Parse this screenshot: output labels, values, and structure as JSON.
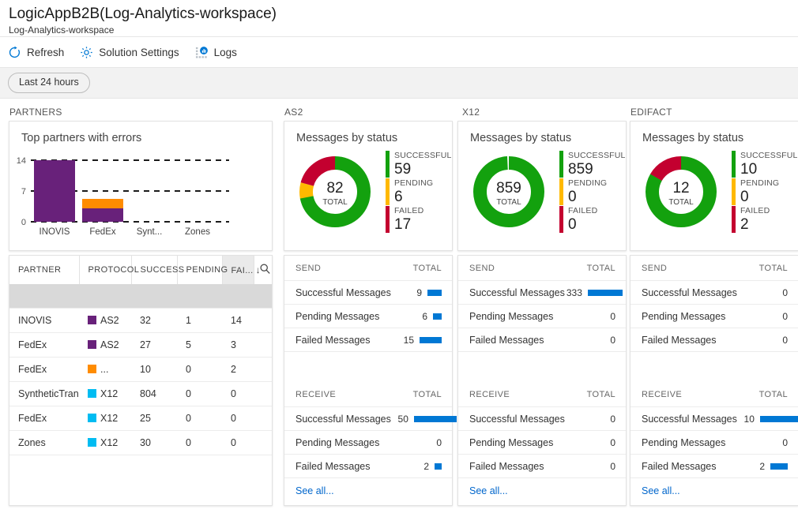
{
  "header": {
    "title": "LogicAppB2B(Log-Analytics-workspace)",
    "subtitle": "Log-Analytics-workspace"
  },
  "toolbar": {
    "refresh_label": "Refresh",
    "settings_label": "Solution Settings",
    "logs_label": "Logs"
  },
  "filter": {
    "time_range": "Last 24 hours"
  },
  "columns": {
    "partners": "PARTNERS",
    "as2": "AS2",
    "x12": "X12",
    "edifact": "EDIFACT"
  },
  "colors": {
    "green": "#13A10E",
    "yellow": "#FFB900",
    "red": "#C3002F",
    "purple": "#68217A",
    "orange": "#FF8C00",
    "cyan": "#00BCF2",
    "blue": "#0078D4",
    "link": "#0066CC"
  },
  "partners_panel": {
    "chart_title": "Top partners with errors",
    "table": {
      "headers": [
        "PARTNER",
        "PROTOCOL",
        "SUCCESS",
        "PENDING",
        "FAI..."
      ],
      "sorted_column": "FAI...",
      "sort_direction": "descending",
      "search_icon": "search-icon",
      "rows": [
        {
          "partner": "INOVIS",
          "protocol": "AS2",
          "protocol_color": "#68217A",
          "success": "32",
          "pending": "1",
          "failed": "14"
        },
        {
          "partner": "FedEx",
          "protocol": "AS2",
          "protocol_color": "#68217A",
          "success": "27",
          "pending": "5",
          "failed": "3"
        },
        {
          "partner": "FedEx",
          "protocol": "...",
          "protocol_color": "#FF8C00",
          "success": "10",
          "pending": "0",
          "failed": "2"
        },
        {
          "partner": "SyntheticTrans",
          "protocol": "X12",
          "protocol_color": "#00BCF2",
          "success": "804",
          "pending": "0",
          "failed": "0"
        },
        {
          "partner": "FedEx",
          "protocol": "X12",
          "protocol_color": "#00BCF2",
          "success": "25",
          "pending": "0",
          "failed": "0"
        },
        {
          "partner": "Zones",
          "protocol": "X12",
          "protocol_color": "#00BCF2",
          "success": "30",
          "pending": "0",
          "failed": "0"
        }
      ]
    }
  },
  "chart_data": [
    {
      "type": "bar",
      "title": "Top partners with errors",
      "stacked": true,
      "categories": [
        "INOVIS",
        "FedEx",
        "Synt...",
        "Zones"
      ],
      "series": [
        {
          "name": "AS2",
          "color": "#68217A",
          "values": [
            14,
            3,
            0,
            0
          ]
        },
        {
          "name": "EDIFACT",
          "color": "#FF8C00",
          "values": [
            0,
            2,
            0,
            0
          ]
        }
      ],
      "ylim": [
        0,
        14
      ],
      "yticks": [
        0,
        7,
        14
      ],
      "ytick_labels": [
        "0",
        "7",
        "14"
      ],
      "xlabel": "",
      "ylabel": "",
      "grid": true,
      "grid_style": "dashed",
      "legend": "none"
    },
    {
      "type": "pie",
      "variant": "donut",
      "panel": "AS2",
      "title": "Messages by status",
      "center_value": "82",
      "center_label": "TOTAL",
      "labels": [
        "SUCCESSFUL",
        "PENDING",
        "FAILED"
      ],
      "values": [
        59,
        6,
        17
      ],
      "colors": [
        "#13A10E",
        "#FFB900",
        "#C3002F"
      ],
      "legend": "right"
    },
    {
      "type": "pie",
      "variant": "donut",
      "panel": "X12",
      "title": "Messages by status",
      "center_value": "859",
      "center_label": "TOTAL",
      "labels": [
        "SUCCESSFUL",
        "PENDING",
        "FAILED"
      ],
      "values": [
        859,
        0,
        0
      ],
      "colors": [
        "#13A10E",
        "#FFB900",
        "#C3002F"
      ],
      "legend": "right"
    },
    {
      "type": "pie",
      "variant": "donut",
      "panel": "EDIFACT",
      "title": "Messages by status",
      "center_value": "12",
      "center_label": "TOTAL",
      "labels": [
        "SUCCESSFUL",
        "PENDING",
        "FAILED"
      ],
      "values": [
        10,
        0,
        2
      ],
      "colors": [
        "#13A10E",
        "#FFB900",
        "#C3002F"
      ],
      "legend": "right"
    },
    {
      "type": "bar",
      "variant": "horizontal",
      "panel": "AS2",
      "section": "SEND",
      "categories": [
        "Successful Messages",
        "Pending Messages",
        "Failed Messages"
      ],
      "values": [
        9,
        6,
        15
      ],
      "color": "#0078D4"
    },
    {
      "type": "bar",
      "variant": "horizontal",
      "panel": "AS2",
      "section": "RECEIVE",
      "categories": [
        "Successful Messages",
        "Pending Messages",
        "Failed Messages"
      ],
      "values": [
        50,
        0,
        2
      ],
      "color": "#0078D4"
    },
    {
      "type": "bar",
      "variant": "horizontal",
      "panel": "X12",
      "section": "SEND",
      "categories": [
        "Successful Messages",
        "Pending Messages",
        "Failed Messages"
      ],
      "values": [
        333,
        0,
        0
      ],
      "color": "#0078D4"
    },
    {
      "type": "bar",
      "variant": "horizontal",
      "panel": "X12",
      "section": "RECEIVE",
      "categories": [
        "Successful Messages",
        "Pending Messages",
        "Failed Messages"
      ],
      "values": [
        0,
        0,
        0
      ],
      "color": "#0078D4"
    },
    {
      "type": "bar",
      "variant": "horizontal",
      "panel": "EDIFACT",
      "section": "SEND",
      "categories": [
        "Successful Messages",
        "Pending Messages",
        "Failed Messages"
      ],
      "values": [
        0,
        0,
        0
      ],
      "color": "#0078D4"
    },
    {
      "type": "bar",
      "variant": "horizontal",
      "panel": "EDIFACT",
      "section": "RECEIVE",
      "categories": [
        "Successful Messages",
        "Pending Messages",
        "Failed Messages"
      ],
      "values": [
        10,
        0,
        2
      ],
      "color": "#0078D4"
    }
  ],
  "protocol_panels": [
    {
      "key": "as2",
      "donut_title": "Messages by status",
      "total": "82",
      "total_label": "TOTAL",
      "legend": [
        {
          "name": "SUCCESSFUL",
          "value": "59",
          "color": "#13A10E"
        },
        {
          "name": "PENDING",
          "value": "6",
          "color": "#FFB900"
        },
        {
          "name": "FAILED",
          "value": "17",
          "color": "#C3002F"
        }
      ],
      "send": {
        "section_label": "SEND",
        "total_label": "TOTAL",
        "rows": [
          {
            "label": "Successful Messages",
            "value": "9",
            "bar": 31
          },
          {
            "label": "Pending Messages",
            "value": "6",
            "bar": 20
          },
          {
            "label": "Failed Messages",
            "value": "15",
            "bar": 44
          }
        ]
      },
      "receive": {
        "section_label": "RECEIVE",
        "total_label": "TOTAL",
        "rows": [
          {
            "label": "Successful Messages",
            "value": "50",
            "bar": 62
          },
          {
            "label": "Pending Messages",
            "value": "0",
            "bar": 0
          },
          {
            "label": "Failed Messages",
            "value": "2",
            "bar": 11
          }
        ]
      },
      "see_all": "See all..."
    },
    {
      "key": "x12",
      "donut_title": "Messages by status",
      "total": "859",
      "total_label": "TOTAL",
      "legend": [
        {
          "name": "SUCCESSFUL",
          "value": "859",
          "color": "#13A10E"
        },
        {
          "name": "PENDING",
          "value": "0",
          "color": "#FFB900"
        },
        {
          "name": "FAILED",
          "value": "0",
          "color": "#C3002F"
        }
      ],
      "send": {
        "section_label": "SEND",
        "total_label": "TOTAL",
        "rows": [
          {
            "label": "Successful Messages",
            "value": "333",
            "bar": 58
          },
          {
            "label": "Pending Messages",
            "value": "0",
            "bar": 0
          },
          {
            "label": "Failed Messages",
            "value": "0",
            "bar": 0
          }
        ]
      },
      "receive": {
        "section_label": "RECEIVE",
        "total_label": "TOTAL",
        "rows": [
          {
            "label": "Successful Messages",
            "value": "0",
            "bar": 0
          },
          {
            "label": "Pending Messages",
            "value": "0",
            "bar": 0
          },
          {
            "label": "Failed Messages",
            "value": "0",
            "bar": 0
          }
        ]
      },
      "see_all": "See all..."
    },
    {
      "key": "edifact",
      "donut_title": "Messages by status",
      "total": "12",
      "total_label": "TOTAL",
      "legend": [
        {
          "name": "SUCCESSFUL",
          "value": "10",
          "color": "#13A10E"
        },
        {
          "name": "PENDING",
          "value": "0",
          "color": "#FFB900"
        },
        {
          "name": "FAILED",
          "value": "2",
          "color": "#C3002F"
        }
      ],
      "send": {
        "section_label": "SEND",
        "total_label": "TOTAL",
        "rows": [
          {
            "label": "Successful Messages",
            "value": "0",
            "bar": 0
          },
          {
            "label": "Pending Messages",
            "value": "0",
            "bar": 0
          },
          {
            "label": "Failed Messages",
            "value": "0",
            "bar": 0
          }
        ]
      },
      "receive": {
        "section_label": "RECEIVE",
        "total_label": "TOTAL",
        "rows": [
          {
            "label": "Successful Messages",
            "value": "10",
            "bar": 62
          },
          {
            "label": "Pending Messages",
            "value": "0",
            "bar": 0
          },
          {
            "label": "Failed Messages",
            "value": "2",
            "bar": 26
          }
        ]
      },
      "see_all": "See all..."
    }
  ]
}
